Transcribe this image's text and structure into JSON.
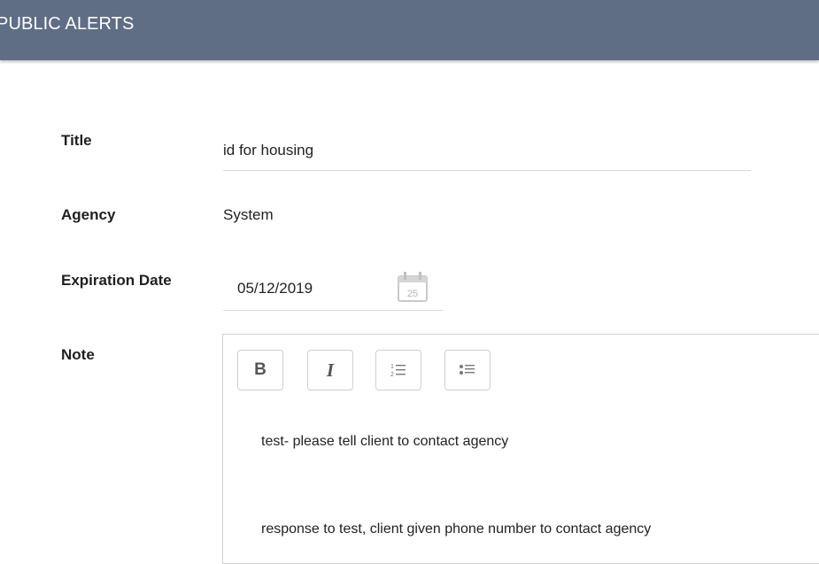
{
  "header": {
    "title": "PUBLIC ALERTS"
  },
  "form": {
    "title_label": "Title",
    "title_value": "id for housing",
    "agency_label": "Agency",
    "agency_value": "System",
    "expiration_label": "Expiration Date",
    "expiration_value": "05/12/2019",
    "calendar_icon_day": "25",
    "note_label": "Note"
  },
  "editor": {
    "toolbar": {
      "bold": "B",
      "italic": "I",
      "ordered_list_icon": "ordered-list-icon",
      "bullet_list_icon": "bullet-list-icon"
    },
    "lines": [
      "test- please tell client to contact agency",
      "response to test, client given phone number to contact agency"
    ]
  },
  "colors": {
    "header_bg": "#5f6d85",
    "header_text": "#ffffff",
    "border": "#cfcfcf"
  }
}
